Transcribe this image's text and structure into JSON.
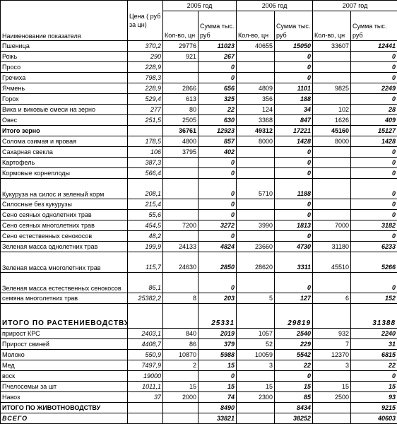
{
  "headers": {
    "name": "Наименование показателя",
    "price": "Цена ( руб за цн)",
    "years": [
      "2005 год",
      "2006 год",
      "2007 год"
    ],
    "qty": "Кол-во, цн",
    "sum": "Сумма тыс. руб"
  },
  "rows": [
    {
      "name": "Пшеница",
      "price": "370,2",
      "q2005": "29776",
      "s2005": "11023",
      "q2006": "40655",
      "s2006": "15050",
      "q2007": "33607",
      "s2007": "12441"
    },
    {
      "name": "Рожь",
      "price": "290",
      "q2005": "921",
      "s2005": "267",
      "q2006": "",
      "s2006": "0",
      "q2007": "",
      "s2007": "0"
    },
    {
      "name": "Просо",
      "price": "228,9",
      "q2005": "",
      "s2005": "0",
      "q2006": "",
      "s2006": "0",
      "q2007": "",
      "s2007": "0"
    },
    {
      "name": "Гречиха",
      "price": "798,3",
      "q2005": "",
      "s2005": "0",
      "q2006": "",
      "s2006": "0",
      "q2007": "",
      "s2007": "0"
    },
    {
      "name": "Ячмень",
      "price": "228,9",
      "q2005": "2866",
      "s2005": "656",
      "q2006": "4809",
      "s2006": "1101",
      "q2007": "9825",
      "s2007": "2249"
    },
    {
      "name": "Горох",
      "price": "529,4",
      "q2005": "613",
      "s2005": "325",
      "q2006": "356",
      "s2006": "188",
      "q2007": "",
      "s2007": "0"
    },
    {
      "name": "Вика и виковые смеси на зерно",
      "price": "277",
      "q2005": "80",
      "s2005": "22",
      "q2006": "124",
      "s2006": "34",
      "q2007": "102",
      "s2007": "28"
    },
    {
      "name": "Овес",
      "price": "251,5",
      "q2005": "2505",
      "s2005": "630",
      "q2006": "3368",
      "s2006": "847",
      "q2007": "1626",
      "s2007": "409"
    },
    {
      "name": "Итого зерно",
      "price": "",
      "q2005": "36761",
      "s2005": "12923",
      "q2006": "49312",
      "s2006": "17221",
      "q2007": "45160",
      "s2007": "15127",
      "bold": true
    },
    {
      "name": "Солома озимая и яровая",
      "price": "178,5",
      "q2005": "4800",
      "s2005": "857",
      "q2006": "8000",
      "s2006": "1428",
      "q2007": "8000",
      "s2007": "1428"
    },
    {
      "name": "Сахарная свекла",
      "price": "106",
      "q2005": "3795",
      "s2005": "402",
      "q2006": "",
      "s2006": "0",
      "q2007": "",
      "s2007": "0"
    },
    {
      "name": "Картофель",
      "price": "387,3",
      "q2005": "",
      "s2005": "0",
      "q2006": "",
      "s2006": "0",
      "q2007": "",
      "s2007": "0"
    },
    {
      "name": "Кормовые корнеплоды",
      "price": "566,4",
      "q2005": "",
      "s2005": "0",
      "q2006": "",
      "s2006": "0",
      "q2007": "",
      "s2007": "0"
    },
    {
      "name": "Кукуруза на силос и зеленый корм",
      "price": "208,1",
      "q2005": "",
      "s2005": "0",
      "q2006": "5710",
      "s2006": "1188",
      "q2007": "",
      "s2007": "0",
      "tall": true
    },
    {
      "name": "Силосные без кукурузы",
      "price": "215,4",
      "q2005": "",
      "s2005": "0",
      "q2006": "",
      "s2006": "0",
      "q2007": "",
      "s2007": "0"
    },
    {
      "name": "Сено сеяных однолетних трав",
      "price": "55,6",
      "q2005": "",
      "s2005": "0",
      "q2006": "",
      "s2006": "0",
      "q2007": "",
      "s2007": "0"
    },
    {
      "name": "Сено сеяных многолетних трав",
      "price": "454,5",
      "q2005": "7200",
      "s2005": "3272",
      "q2006": "3990",
      "s2006": "1813",
      "q2007": "7000",
      "s2007": "3182"
    },
    {
      "name": "Сено естественных сенокосов",
      "price": "48,2",
      "q2005": "",
      "s2005": "0",
      "q2006": "",
      "s2006": "0",
      "q2007": "",
      "s2007": "0"
    },
    {
      "name": "Зеленая масса однолетних трав",
      "price": "199,9",
      "q2005": "24133",
      "s2005": "4824",
      "q2006": "23660",
      "s2006": "4730",
      "q2007": "31180",
      "s2007": "6233"
    },
    {
      "name": "Зеленая масса многолетних трав",
      "price": "115,7",
      "q2005": "24630",
      "s2005": "2850",
      "q2006": "28620",
      "s2006": "3311",
      "q2007": "45510",
      "s2007": "5266",
      "tall": true
    },
    {
      "name": "Зеленая масса естественных сенокосов",
      "price": "86,1",
      "q2005": "",
      "s2005": "0",
      "q2006": "",
      "s2006": "0",
      "q2007": "",
      "s2007": "0",
      "tall": true
    },
    {
      "name": "семяна многолетних трав",
      "price": "25382,2",
      "q2005": "8",
      "s2005": "203",
      "q2006": "5",
      "s2006": "127",
      "q2007": "6",
      "s2007": "152"
    },
    {
      "name": "ИТОГО ПО РАСТЕНИЕВОДСТВУ",
      "price": "",
      "q2005": "",
      "s2005": "25331",
      "q2006": "",
      "s2006": "29819",
      "q2007": "",
      "s2007": "31388",
      "bold": true,
      "xtall": true,
      "big": true
    },
    {
      "name": "прирост КРС",
      "price": "2403,1",
      "q2005": "840",
      "s2005": "2019",
      "q2006": "1057",
      "s2006": "2540",
      "q2007": "932",
      "s2007": "2240"
    },
    {
      "name": "Прирост свиней",
      "price": "4408,7",
      "q2005": "86",
      "s2005": "379",
      "q2006": "52",
      "s2006": "229",
      "q2007": "7",
      "s2007": "31"
    },
    {
      "name": "Молоко",
      "price": "550,9",
      "q2005": "10870",
      "s2005": "5988",
      "q2006": "10059",
      "s2006": "5542",
      "q2007": "12370",
      "s2007": "6815"
    },
    {
      "name": "Мед",
      "price": "7497,9",
      "q2005": "2",
      "s2005": "15",
      "q2006": "3",
      "s2006": "22",
      "q2007": "3",
      "s2007": "22"
    },
    {
      "name": "воск",
      "price": "19000",
      "q2005": "",
      "s2005": "0",
      "q2006": "",
      "s2006": "0",
      "q2007": "",
      "s2007": "0"
    },
    {
      "name": "Пчелосемьи за шт",
      "price": "1011,1",
      "q2005": "15",
      "s2005": "15",
      "q2006": "15",
      "s2006": "15",
      "q2007": "15",
      "s2007": "15"
    },
    {
      "name": "Навоз",
      "price": "37",
      "q2005": "2000",
      "s2005": "74",
      "q2006": "2300",
      "s2006": "85",
      "q2007": "2500",
      "s2007": "93"
    },
    {
      "name": "ИТОГО ПО ЖИВОТНОВОДСТВУ",
      "price": "",
      "q2005": "",
      "s2005": "8490",
      "q2006": "",
      "s2006": "8434",
      "q2007": "",
      "s2007": "9215",
      "bold": true
    },
    {
      "name": "ВСЕГО",
      "price": "",
      "q2005": "",
      "s2005": "33821",
      "q2006": "",
      "s2006": "38252",
      "q2007": "",
      "s2007": "40603",
      "bold": true,
      "total": true
    }
  ]
}
